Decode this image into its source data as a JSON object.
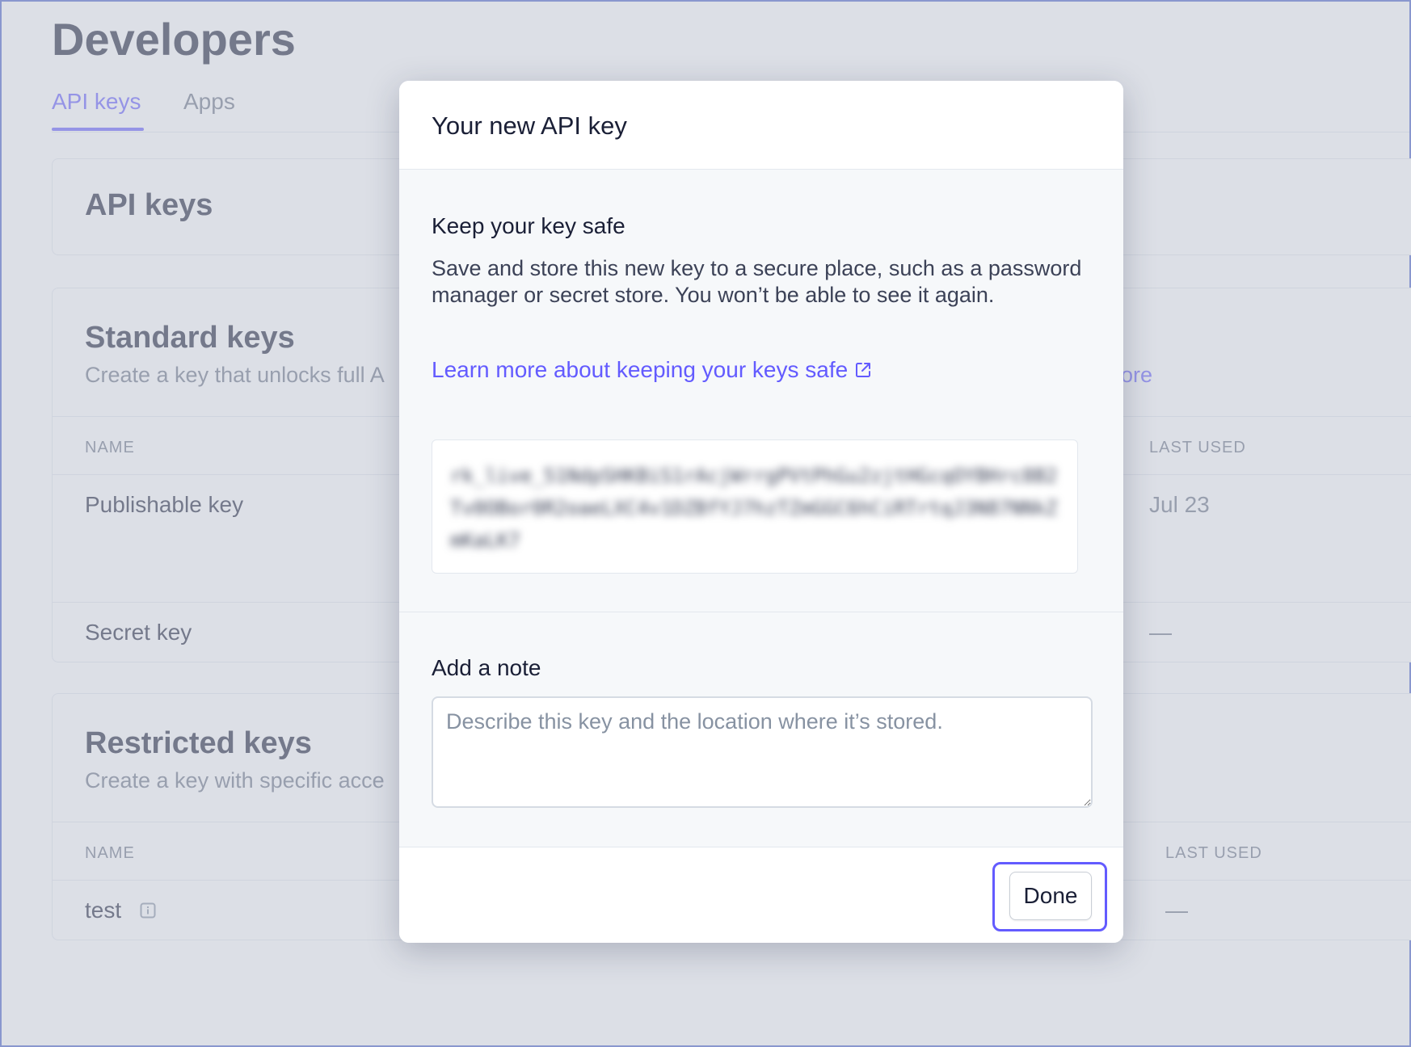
{
  "background": {
    "page_title": "Developers",
    "tabs": [
      {
        "label": "API keys",
        "active": true
      },
      {
        "label": "Apps",
        "active": false
      }
    ],
    "api_keys_card": {
      "title": "API keys"
    },
    "standard_keys": {
      "title": "Standard keys",
      "subtitle": "Create a key that unlocks full A",
      "subtitle_tail": "ore",
      "col_name": "NAME",
      "col_last_used": "LAST USED",
      "rows": [
        {
          "name": "Publishable key",
          "last_used": "Jul 23"
        },
        {
          "name": "Secret key",
          "last_used": "—"
        }
      ]
    },
    "restricted_keys": {
      "title": "Restricted keys",
      "subtitle": "Create a key with specific acce",
      "col_name": "NAME",
      "col_last_used": "LAST USED",
      "rows": [
        {
          "name": "test",
          "last_used": "—"
        }
      ]
    }
  },
  "modal": {
    "title": "Your new API key",
    "safe_heading": "Keep your key safe",
    "safe_body": "Save and store this new key to a secure place, such as a password manager or secret store. You won’t be able to see it again.",
    "learn_more_label": "Learn more about keeping your keys safe",
    "api_key_value": "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",
    "note_heading": "Add a note",
    "note_placeholder": "Describe this key and the location where it’s stored.",
    "done_label": "Done"
  },
  "colors": {
    "accent": "#635bff",
    "overlay": "#d5d9e2"
  },
  "icons": {
    "learn_more": "external-link-icon",
    "test_row": "info-icon"
  }
}
